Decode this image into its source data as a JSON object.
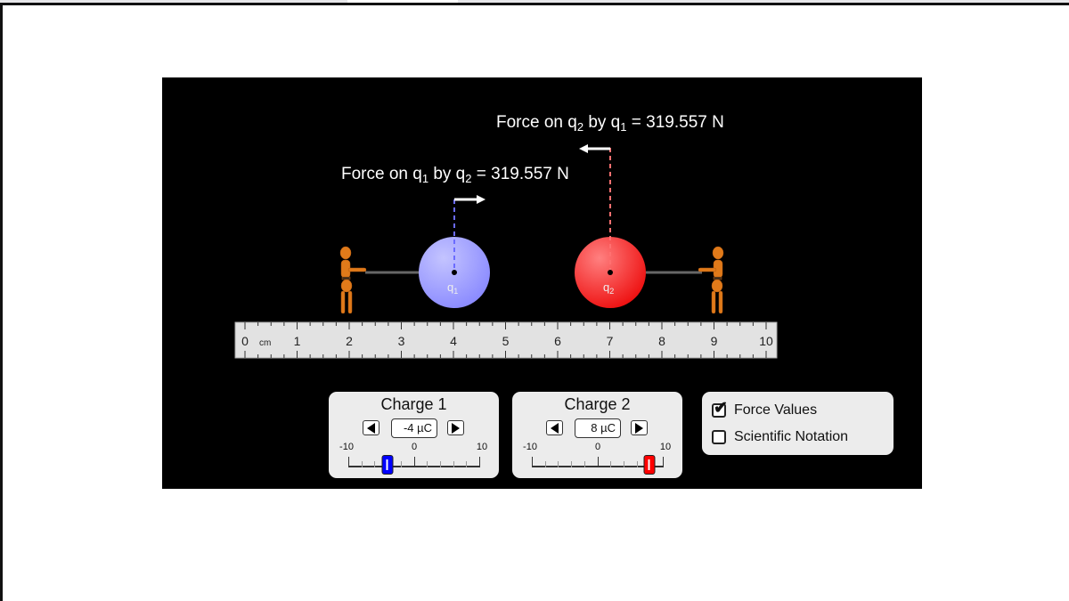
{
  "forces": {
    "on_q2": {
      "prefix": "Force on q",
      "sub1": "2",
      "mid": " by q",
      "sub2": "1",
      "value": " = 319.557 N"
    },
    "on_q1": {
      "prefix": "Force on q",
      "sub1": "1",
      "mid": " by q",
      "sub2": "2",
      "value": " = 319.557 N"
    }
  },
  "charges": {
    "q1": {
      "symbol": "q",
      "sub": "1",
      "color": "#9d9dff",
      "position_cm": 4
    },
    "q2": {
      "symbol": "q",
      "sub": "2",
      "color": "#ff3030",
      "position_cm": 7
    }
  },
  "ruler": {
    "unit": "cm",
    "labels": [
      "0",
      "1",
      "2",
      "3",
      "4",
      "5",
      "6",
      "7",
      "8",
      "9",
      "10"
    ]
  },
  "charge1_panel": {
    "title": "Charge 1",
    "value": "-4 µC",
    "numeric_value": -4,
    "min_label": "-10",
    "mid_label": "0",
    "max_label": "10",
    "min": -10,
    "max": 10,
    "thumb_color": "#0000ff"
  },
  "charge2_panel": {
    "title": "Charge 2",
    "value": "8 µC",
    "numeric_value": 8,
    "min_label": "-10",
    "mid_label": "0",
    "max_label": "10",
    "min": -10,
    "max": 10,
    "thumb_color": "#ff0000"
  },
  "options": {
    "force_values": {
      "label": "Force Values",
      "checked": true
    },
    "scientific_notation": {
      "label": "Scientific Notation",
      "checked": false
    }
  }
}
